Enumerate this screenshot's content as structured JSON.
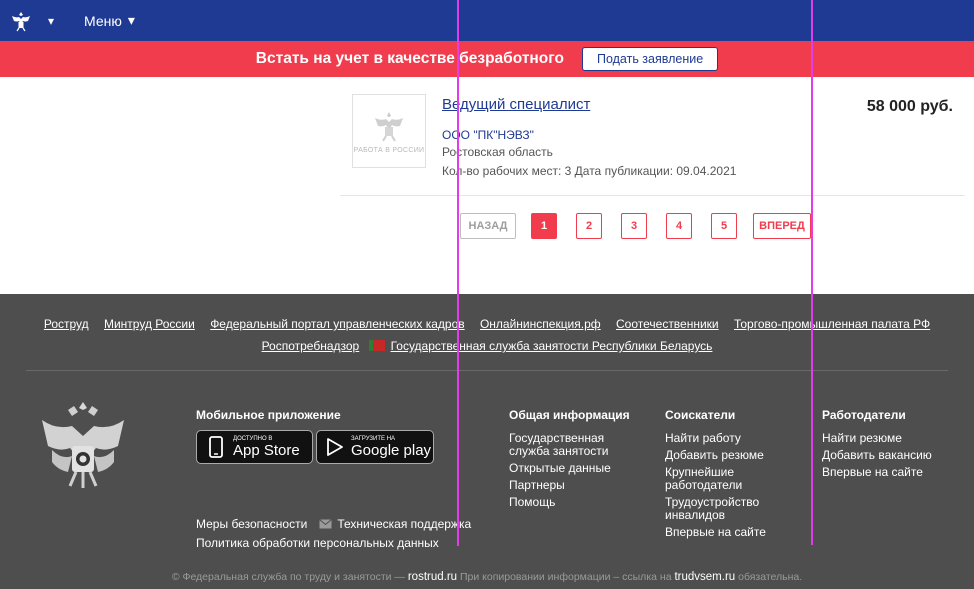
{
  "nav": {
    "menu_label": "Меню",
    "chevron": "▾"
  },
  "banner": {
    "text": "Встать на учет в качестве безработного",
    "button_label": "Подать заявление"
  },
  "job": {
    "logo_text": "РАБОТА В РОССИИ",
    "title": "Ведущий специалист",
    "company": "ООО \"ПК\"НЭВЗ\"",
    "region": "Ростовская область",
    "meta": "Кол-во рабочих мест: 3  Дата публикации: 09.04.2021",
    "salary": "58 000 руб."
  },
  "pagination": {
    "back": "НАЗАД",
    "pages": [
      "1",
      "2",
      "3",
      "4",
      "5"
    ],
    "next": "ВПЕРЕД",
    "active": "1"
  },
  "footer": {
    "links_row1": [
      "Роструд",
      "Минтруд России",
      "Федеральный портал управленческих кадров",
      "Онлайнинспекция.рф",
      "Соотечественники",
      "Торгово-промышленная палата РФ"
    ],
    "links_row2": [
      "Роспотребнадзор",
      "Государственная служба занятости Республики Беларусь"
    ],
    "mobile_title": "Мобильное приложение",
    "appstore_small": "Доступно в",
    "appstore_big": "App Store",
    "google_small": "ЗАГРУЗИТЕ НА",
    "google_big": "Google play",
    "security": "Меры безопасности",
    "support": "Техническая поддержка",
    "policy": "Политика обработки персональных данных",
    "col_general": {
      "title": "Общая информация",
      "items": [
        "Государственная служба занятости",
        "Открытые данные",
        "Партнеры",
        "Помощь"
      ]
    },
    "col_seekers": {
      "title": "Соискатели",
      "items": [
        "Найти работу",
        "Добавить резюме",
        "Крупнейшие работодатели",
        "Трудоустройство инвалидов",
        "Впервые на сайте"
      ]
    },
    "col_employers": {
      "title": "Работодатели",
      "items": [
        "Найти резюме",
        "Добавить вакансию",
        "Впервые на сайте"
      ]
    },
    "copyright_pre": "© Федеральная служба по труду и занятости —",
    "copyright_site1": "rostrud.ru",
    "copyright_mid": "При копировании информации – ссылка на",
    "copyright_site2": "trudvsem.ru",
    "copyright_post": "обязательна."
  },
  "colors": {
    "nav_bg": "#1f3a93",
    "banner_bg": "#f03c4c",
    "footer_bg": "#4e4e4e",
    "guide": "#e23de8"
  }
}
